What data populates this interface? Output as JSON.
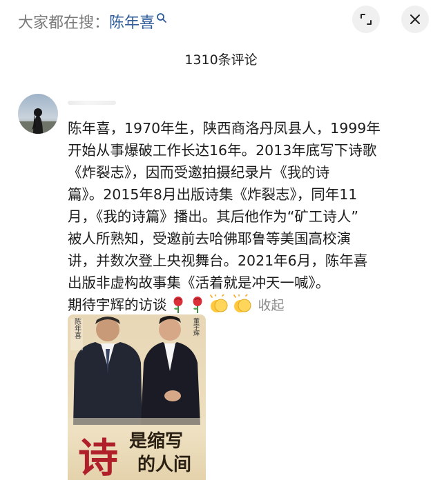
{
  "search": {
    "prefix": "大家都在搜：",
    "keyword": "陈年喜"
  },
  "icons": {
    "search": "search-icon",
    "expand": "expand-icon",
    "close": "close-icon"
  },
  "header": {
    "comment_count": "1310条评论"
  },
  "comment": {
    "lines": [
      "陈年喜，1970年生，陕西商洛丹凤县人，1999年",
      "开始从事爆破工作长达16年。2013年底写下诗歌",
      "《炸裂志》，因而受邀拍摄纪录片《我的诗",
      "篇》。2015年8月出版诗集《炸裂志》，同年11",
      "月，《我的诗篇》播出。其后他作为“矿工诗人”",
      "被人所熟知，受邀前去哈佛耶鲁等美国高校演",
      "讲，并数次登上央视舞台。2021年6月，陈年喜",
      "出版非虚构故事集《活着就是冲天一喊》。"
    ],
    "last_line": "期待宇辉的访谈",
    "emojis": [
      "rose-emoji",
      "rose-emoji",
      "clapping-hands-emoji",
      "clapping-hands-emoji"
    ],
    "collapse_label": "收起"
  },
  "image": {
    "poster_name_left": "陈年喜",
    "poster_name_right": "董宇辉",
    "poster_title_big": "诗",
    "poster_title_small_1": "是缩写",
    "poster_title_small_2": "的人间"
  }
}
